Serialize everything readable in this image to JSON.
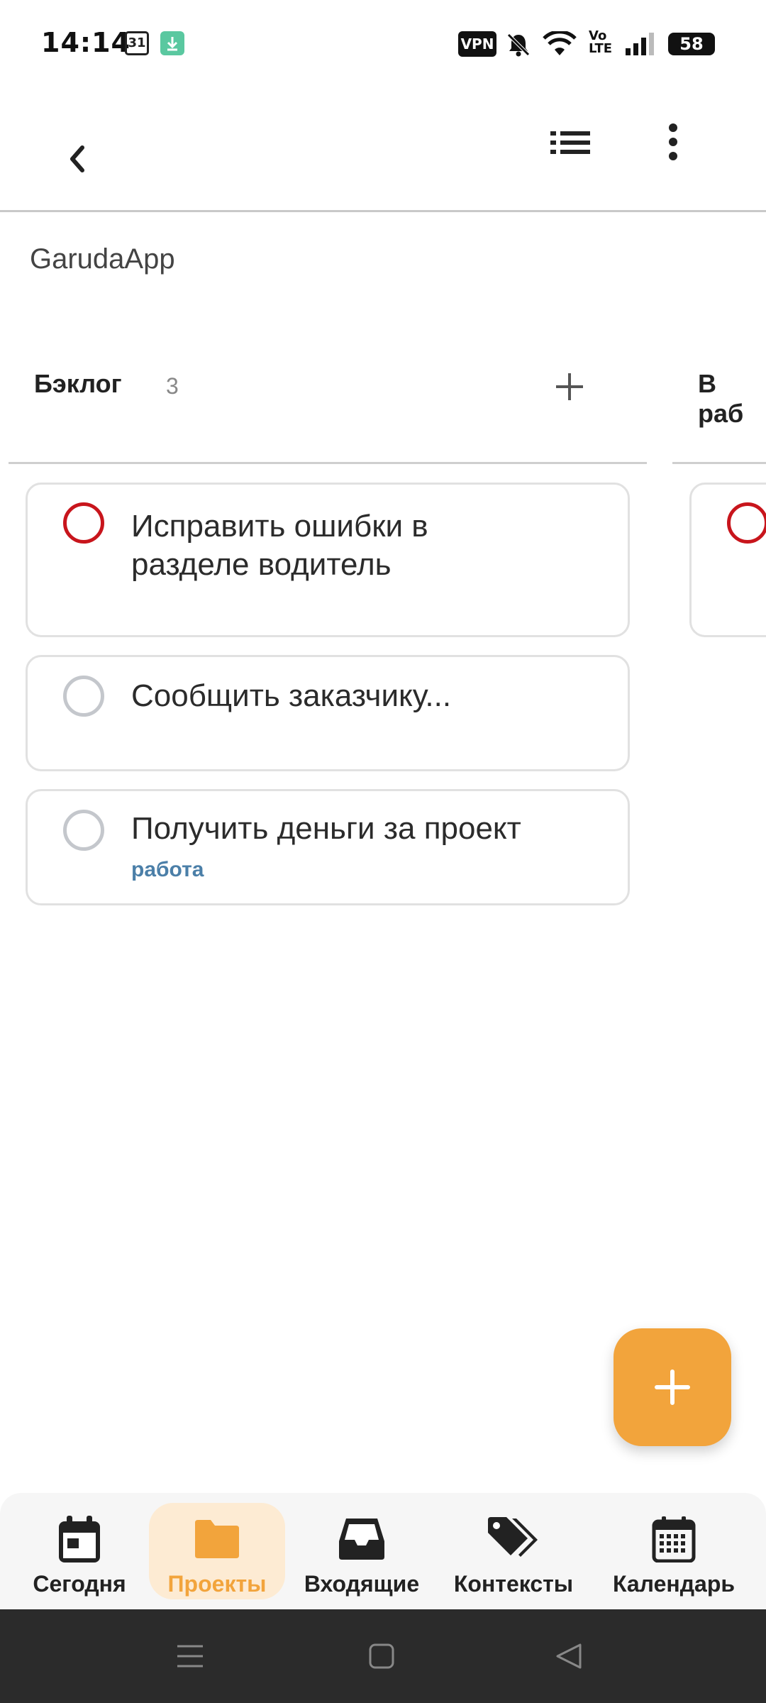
{
  "status_bar": {
    "time": "14:14",
    "calendar_day": "31",
    "vpn": "VPN",
    "volte_top": "Vo",
    "volte_bottom": "LTE",
    "battery": "58"
  },
  "app_bar": {
    "back_icon": "chevron-left-icon",
    "list_icon": "list-icon",
    "more_icon": "more-vertical-icon"
  },
  "project": {
    "title": "GarudaApp"
  },
  "columns": [
    {
      "title": "Бэклог",
      "count": "3",
      "tasks": [
        {
          "text_line1": "Исправить ошибки в",
          "text_line2": "разделе водитель",
          "priority": "high"
        },
        {
          "text": "Сообщить заказчику...",
          "priority": "none"
        },
        {
          "text": "Получить деньги за проект",
          "tag": "работа",
          "priority": "none"
        }
      ]
    },
    {
      "title": "В раб"
    }
  ],
  "fab": {
    "icon": "plus-icon"
  },
  "bottom_nav": [
    {
      "label": "Сегодня",
      "icon": "calendar-day-icon",
      "active": false
    },
    {
      "label": "Проекты",
      "icon": "folder-icon",
      "active": true
    },
    {
      "label": "Входящие",
      "icon": "inbox-icon",
      "active": false
    },
    {
      "label": "Контексты",
      "icon": "tags-icon",
      "active": false
    },
    {
      "label": "Календарь",
      "icon": "calendar-icon",
      "active": false
    }
  ],
  "colors": {
    "accent": "#f2a43c",
    "priority_red": "#c8151c",
    "tag_blue": "#4b7fa8"
  }
}
